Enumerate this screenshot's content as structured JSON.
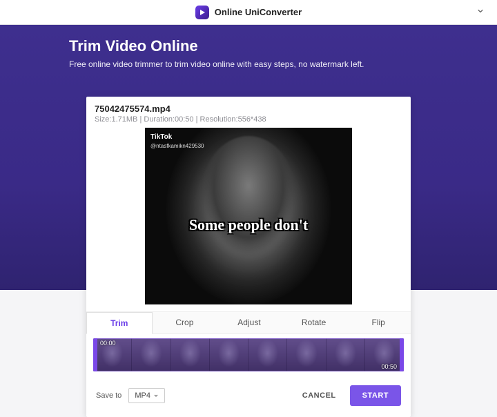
{
  "brand": {
    "name": "Online UniConverter"
  },
  "hero": {
    "title": "Trim Video Online",
    "subtitle": "Free online video trimmer to trim video online with easy steps, no watermark left."
  },
  "file": {
    "name": "75042475574.mp4",
    "size": "1.71MB",
    "duration": "00:50",
    "resolution": "556*438",
    "meta_format": "Size:{size} | Duration:{duration} | Resolution:{resolution}"
  },
  "video": {
    "watermark": "TikTok",
    "user": "@ntasfkamikn429530",
    "caption": "Some people don't"
  },
  "tabs": [
    {
      "id": "trim",
      "label": "Trim",
      "active": true
    },
    {
      "id": "crop",
      "label": "Crop",
      "active": false
    },
    {
      "id": "adjust",
      "label": "Adjust",
      "active": false
    },
    {
      "id": "rotate",
      "label": "Rotate",
      "active": false
    },
    {
      "id": "flip",
      "label": "Flip",
      "active": false
    }
  ],
  "timeline": {
    "start": "00:00",
    "end": "00:50"
  },
  "footer": {
    "save_to_label": "Save to",
    "format": "MP4",
    "cancel": "CANCEL",
    "start": "START"
  }
}
